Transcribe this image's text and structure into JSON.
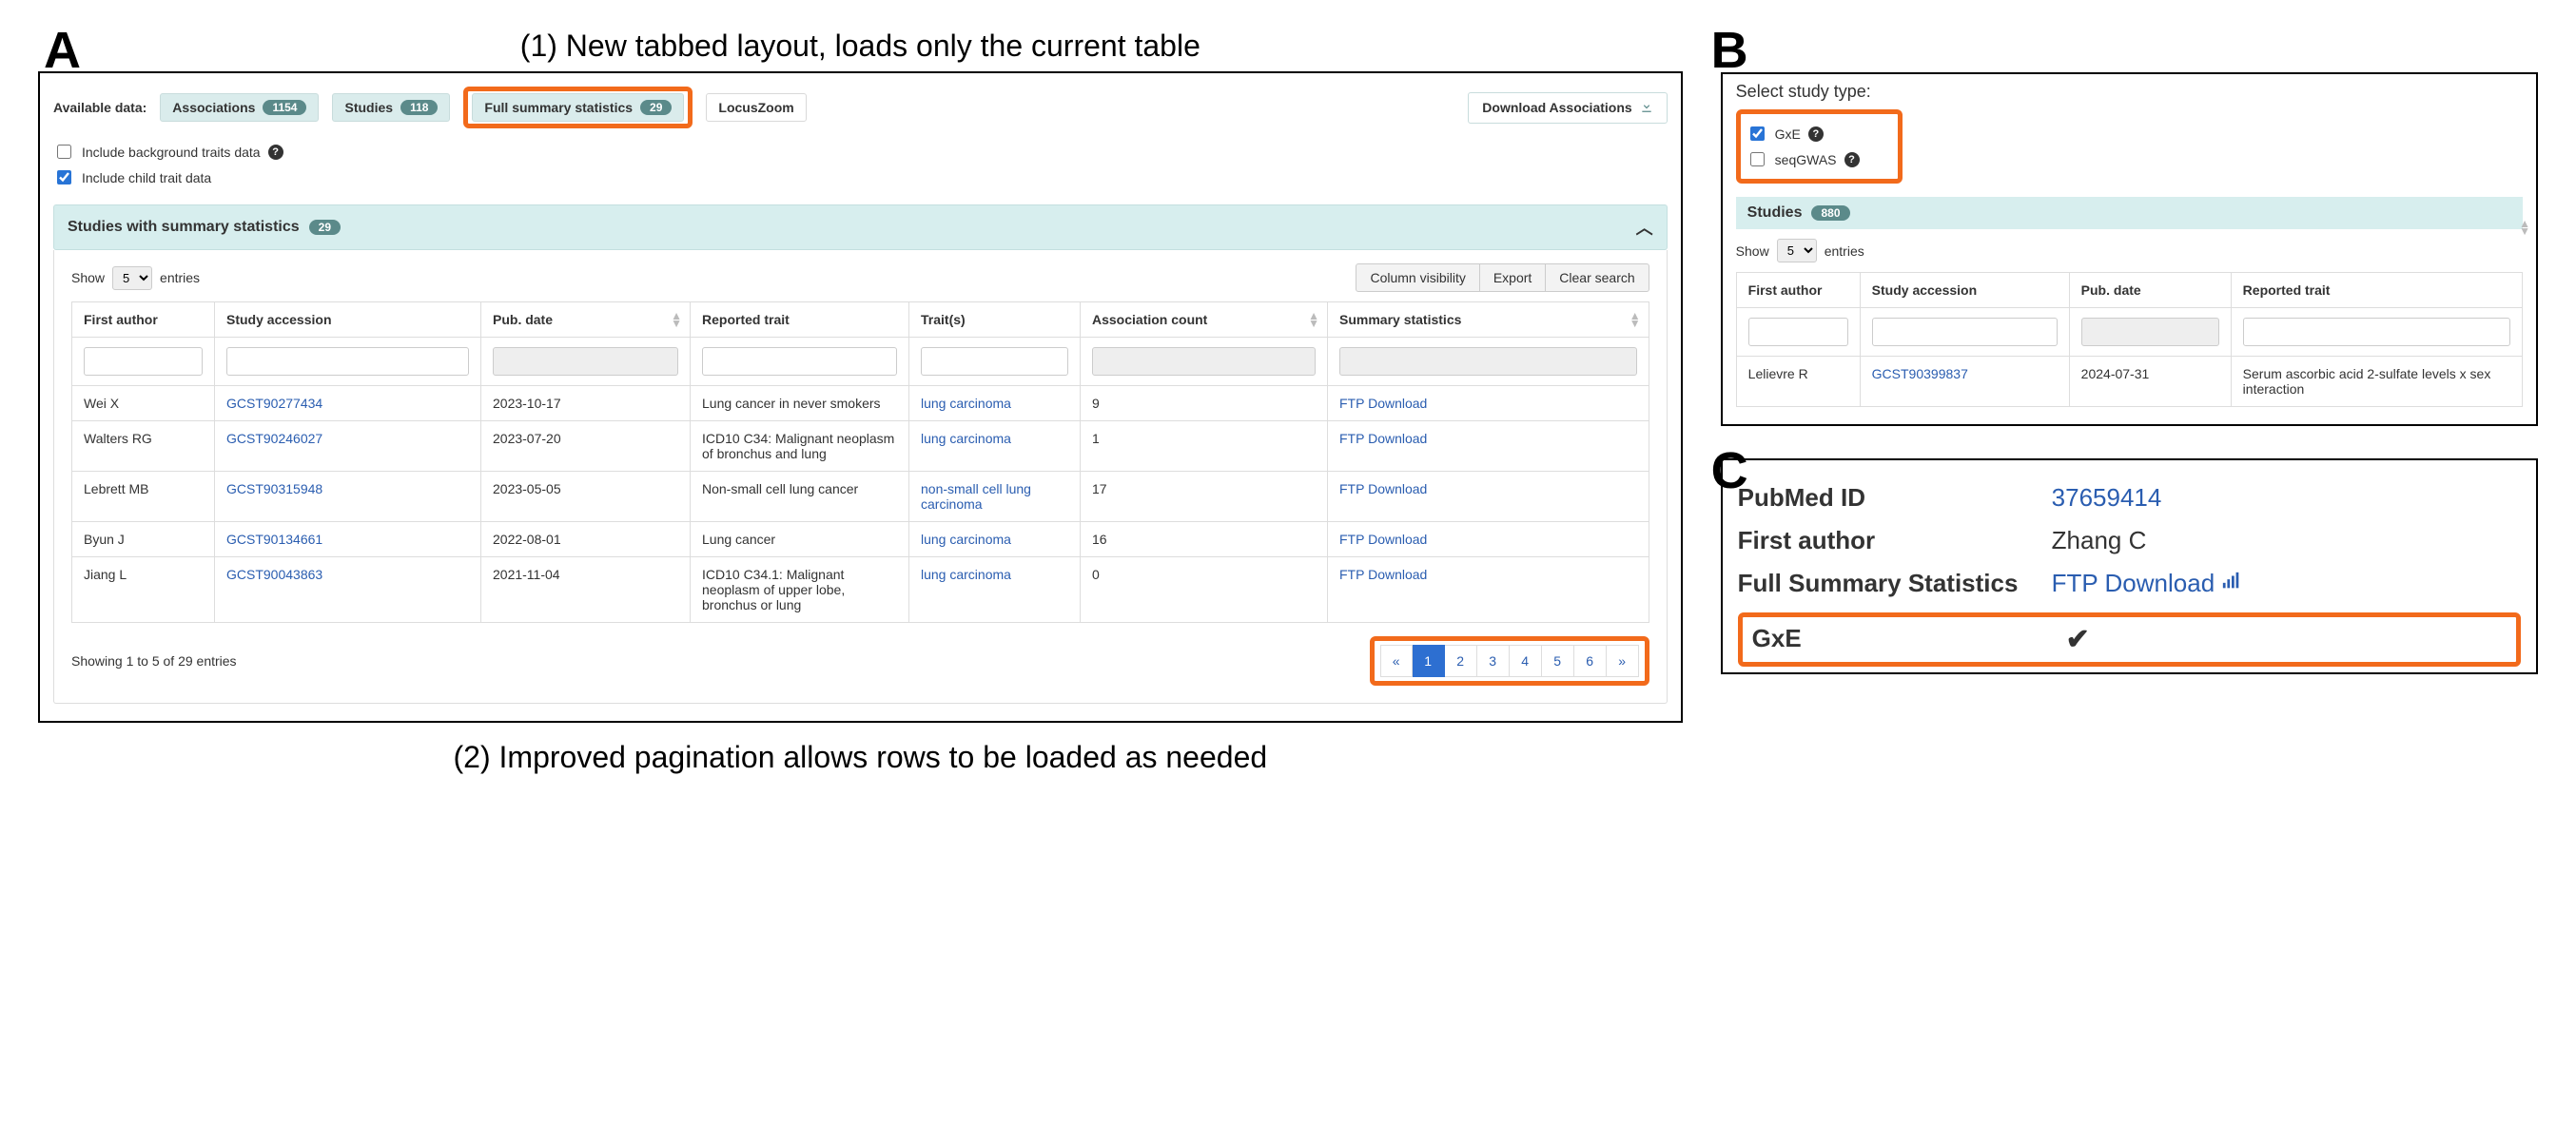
{
  "captions": {
    "top": "(1) New tabbed layout, loads only the current table",
    "bottom": "(2) Improved pagination allows rows to be loaded as needed"
  },
  "panelA": {
    "label": "A",
    "available_data_label": "Available data:",
    "tabs": {
      "assoc": {
        "label": "Associations",
        "count": "1154"
      },
      "studies": {
        "label": "Studies",
        "count": "118"
      },
      "full": {
        "label": "Full summary statistics",
        "count": "29"
      },
      "locuszoom": {
        "label": "LocusZoom"
      }
    },
    "download_assoc": "Download Associations",
    "include_bg": "Include background traits data",
    "include_child": "Include child trait data",
    "section_title": "Studies with summary statistics",
    "section_count": "29",
    "show_word": "Show",
    "show_value": "5",
    "entries_word": "entries",
    "tool_buttons": {
      "colvis": "Column visibility",
      "export": "Export",
      "clear": "Clear search"
    },
    "columns": {
      "first_author": "First author",
      "study_accession": "Study accession",
      "pub_date": "Pub. date",
      "reported_trait": "Reported trait",
      "traits": "Trait(s)",
      "assoc_count": "Association count",
      "summary_stats": "Summary statistics"
    },
    "rows": [
      {
        "author": "Wei X",
        "accession": "GCST90277434",
        "date": "2023-10-17",
        "reported": "Lung cancer in never smokers",
        "trait": "lung carcinoma",
        "count": "9",
        "ss": "FTP Download"
      },
      {
        "author": "Walters RG",
        "accession": "GCST90246027",
        "date": "2023-07-20",
        "reported": "ICD10 C34: Malignant neoplasm of bronchus and lung",
        "trait": "lung carcinoma",
        "count": "1",
        "ss": "FTP Download"
      },
      {
        "author": "Lebrett MB",
        "accession": "GCST90315948",
        "date": "2023-05-05",
        "reported": "Non-small cell lung cancer",
        "trait": "non-small cell lung carcinoma",
        "count": "17",
        "ss": "FTP Download"
      },
      {
        "author": "Byun J",
        "accession": "GCST90134661",
        "date": "2022-08-01",
        "reported": "Lung cancer",
        "trait": "lung carcinoma",
        "count": "16",
        "ss": "FTP Download"
      },
      {
        "author": "Jiang L",
        "accession": "GCST90043863",
        "date": "2021-11-04",
        "reported": "ICD10 C34.1: Malignant neoplasm of upper lobe, bronchus or lung",
        "trait": "lung carcinoma",
        "count": "0",
        "ss": "FTP Download"
      }
    ],
    "footer_info": "Showing 1 to 5 of 29 entries",
    "pager": {
      "prev": "«",
      "next": "»",
      "pages": [
        "1",
        "2",
        "3",
        "4",
        "5",
        "6"
      ],
      "active": "1"
    }
  },
  "panelB": {
    "label": "B",
    "title": "Select study type:",
    "gxe": "GxE",
    "seqgwas": "seqGWAS",
    "section_title": "Studies",
    "section_count": "880",
    "show_word": "Show",
    "show_value": "5",
    "entries_word": "entries",
    "columns": {
      "first_author": "First author",
      "study_accession": "Study accession",
      "pub_date": "Pub. date",
      "reported_trait": "Reported trait"
    },
    "row": {
      "author": "Lelievre R",
      "accession": "GCST90399837",
      "date": "2024-07-31",
      "reported": "Serum ascorbic acid 2-sulfate levels x sex interaction"
    }
  },
  "panelC": {
    "label": "C",
    "pubmed_label": "PubMed ID",
    "pubmed_value": "37659414",
    "first_author_label": "First author",
    "first_author_value": "Zhang C",
    "full_ss_label": "Full Summary Statistics",
    "full_ss_value": "FTP Download",
    "gxe_label": "GxE",
    "gxe_check": "✔"
  }
}
